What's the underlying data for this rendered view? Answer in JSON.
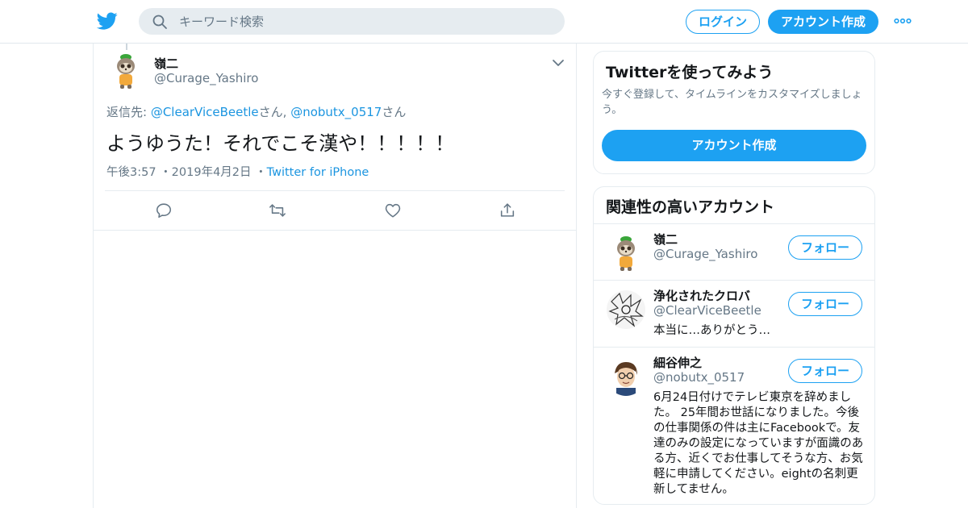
{
  "header": {
    "search_placeholder": "キーワード検索",
    "login_label": "ログイン",
    "signup_label": "アカウント作成"
  },
  "tweet": {
    "author_name": "嶺二",
    "author_handle": "@Curage_Yashiro",
    "replying_prefix": "返信先: ",
    "reply_to_1": "@ClearViceBeetle",
    "san_1": "さん, ",
    "reply_to_2": "@nobutx_0517",
    "san_2": "さん",
    "text": "ようゆうた！それでこそ漢や！！！！！",
    "time": "午後3:57",
    "date": "2019年4月2日",
    "source": "Twitter for iPhone"
  },
  "signup_card": {
    "title": "Twitterを使ってみよう",
    "description": "今すぐ登録して、タイムラインをカスタマイズしましょう。",
    "button_label": "アカウント作成"
  },
  "related": {
    "title": "関連性の高いアカウント",
    "accounts": [
      {
        "name": "嶺二",
        "handle": "@Curage_Yashiro",
        "bio": "",
        "follow_label": "フォロー"
      },
      {
        "name": "浄化されたクロバ",
        "handle": "@ClearViceBeetle",
        "bio": "本当に…ありがとう…",
        "follow_label": "フォロー"
      },
      {
        "name": "細谷伸之",
        "handle": "@nobutx_0517",
        "bio": "6月24日付けでテレビ東京を辞めました。 25年間お世話になりました。今後の仕事関係の件は主にFacebookで。友達のみの設定になっていますが面識のある方、近くでお仕事してそうな方、お気軽に申請してください。eightの名刺更新してません。",
        "follow_label": "フォロー"
      }
    ]
  },
  "colors": {
    "accent": "#1da1f2",
    "link": "#1b95e0",
    "secondary_text": "#657786",
    "border": "#e6ecf0"
  },
  "icons": [
    "twitter-bird-icon",
    "search-icon",
    "more-icon",
    "chevron-down-icon",
    "reply-icon",
    "retweet-icon",
    "like-icon",
    "share-icon"
  ]
}
